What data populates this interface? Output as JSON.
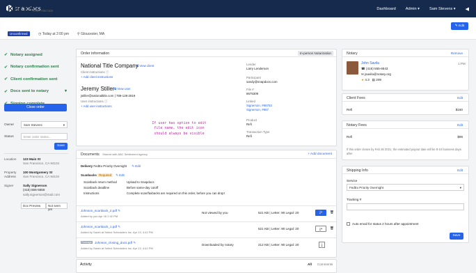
{
  "nav": {
    "logo": "snapdocs",
    "links": [
      "Dashboard",
      "Admin ▾",
      "Sam Stevens ▾"
    ]
  },
  "header": {
    "title": "KELLY",
    "order_no": "Order #867309",
    "status": "Unconfirmed",
    "time": "Today at 2:00 pm",
    "location": "Gloucester, MA",
    "edit": "Edit"
  },
  "steps": [
    "Notary assigned",
    "Notary confirmation sent",
    "Client confirmation sent",
    "Docs sent to notary",
    "Signing complete"
  ],
  "close_order": "Close order",
  "owner": {
    "label": "Owner",
    "value": "Sam Stevens"
  },
  "status": {
    "label": "Status",
    "placeholder": "Enter order status...",
    "save": "Save"
  },
  "location": {
    "label": "Location",
    "lines": [
      "123 Main St",
      "San Francisco, CA 94104"
    ]
  },
  "property": {
    "label": "Property Address",
    "lines": [
      "100 Montgomery St",
      "San Francisco, CA 94104"
    ]
  },
  "signer": {
    "label": "Signer",
    "name": "Sally Signerson",
    "phone": "(415) 555-5555",
    "email": "sally.signerson@mail.com",
    "doc_preview": "Doc Preview",
    "not_seen": "Not seen yet"
  },
  "order_info": {
    "heading": "Order information",
    "tag": "In-person Notarization",
    "company": "National Title Company",
    "view_client": "View client",
    "client_instructions": "Client instructions",
    "add_client": "Add client instructions",
    "user_name": "Jeremy Stiller",
    "view_user": "View user",
    "user_contact": "jstiller@nationaltitle.com | 789-128-2819",
    "user_instructions": "User instructions",
    "add_user": "Add user instructions",
    "lender_label": "Lender",
    "lender": "Larry Lenderson",
    "participant_label": "Participant",
    "participant": "sandy@snapdocs.com",
    "file_label": "File #",
    "file": "8675309",
    "linked_label": "Linked",
    "linked": [
      "Signerson, #86753",
      "Signerson, #867"
    ],
    "product_label": "Product",
    "product": "Refi",
    "transaction_label": "Transaction Type",
    "transaction": "Refi"
  },
  "annotation": "If user has option to edit file name, the edit icon should always be visible",
  "documents": {
    "heading": "Documents",
    "shared": "Shared with ABC Settlement Agency",
    "add": "+ Add document",
    "delivery_label": "Delivery",
    "delivery": "FedEx Priority Overnight",
    "edit": "Edit",
    "scanbacks": "Scanbacks",
    "required": "Required",
    "rows": [
      {
        "k": "Scanback return method",
        "v": "Upload to Snapdocs"
      },
      {
        "k": "Scanback deadline",
        "v": "Before same-day cutoff"
      },
      {
        "k": "Instructions",
        "v": "Complete scan/faxbacks are required on this order, before you can drop!"
      }
    ],
    "files": [
      {
        "name": "Johnson_scanback_2.pdf",
        "added": "Added by you Apr 16 2:42 PM",
        "viewed": "Not viewed by you",
        "size": "521 KB | Letter: 90 Legal: 20"
      },
      {
        "name": "Johnson_scanback_1.pdf",
        "added": "Added by Sarah at Select Schedulers Inc. Apr 13, 4:42 PM",
        "viewed": "",
        "size": "521 KB | Letter: 90 Legal: 20"
      },
      {
        "name": "Johnson_closing_docs.pdf",
        "added": "Added by Sarah at Select Schedulers Inc. Apr 13, 4:42 PM",
        "viewed": "Downloaded by notary",
        "size": "212 KB | Letter: 90 Legal: 20",
        "tag": "Package"
      }
    ]
  },
  "activity": {
    "heading": "Activity",
    "all": "All",
    "comments": "Comments"
  },
  "notary": {
    "heading": "Notary",
    "remove": "Remove",
    "name": "John Savila",
    "time": "1:PM",
    "phone": "(415) 555-6543",
    "email": "jsavila@notary.org",
    "rating": "4.3",
    "count": "209"
  },
  "client_fees": {
    "heading": "Client Fees",
    "edit": "Edit",
    "item": "Refi",
    "amount": "$150"
  },
  "notary_fees": {
    "heading": "Notary Fees",
    "edit": "Edit",
    "item": "Refi",
    "amount": "$95",
    "note": "If this order closes by Feb 26 2021, the estimated payout date will be 8-10 business days after"
  },
  "shipping": {
    "heading": "Shipping Info",
    "edit": "Edit",
    "service_label": "Service",
    "service": "FedEx Priority Overnight",
    "tracking_label": "Tracking #",
    "auto_email": "Auto email for status 2 hours after appointment",
    "save": "Save"
  }
}
